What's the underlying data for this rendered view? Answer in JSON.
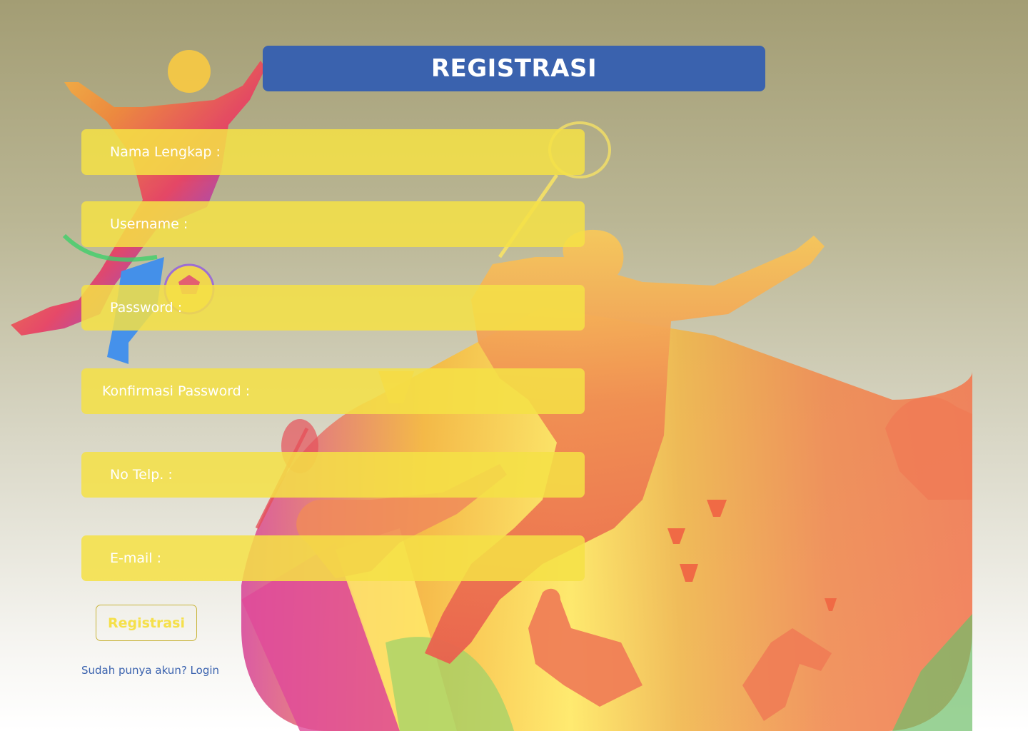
{
  "page": {
    "title": "REGISTRASI"
  },
  "form": {
    "fields": [
      {
        "label": "Nama Lengkap :",
        "value": ""
      },
      {
        "label": "Username :",
        "value": ""
      },
      {
        "label": "Password :",
        "value": ""
      },
      {
        "label": "Konfirmasi Password :",
        "value": ""
      },
      {
        "label": "No Telp. :",
        "value": ""
      },
      {
        "label": "E-mail :",
        "value": ""
      }
    ],
    "submit_label": "Registrasi",
    "login_prompt": "Sudah punya akun? Login"
  },
  "colors": {
    "title_bar": "#3a62ae",
    "field_bg": "#f5e146",
    "button_text": "#f5e04a",
    "link": "#3a62ae"
  },
  "icons": {
    "background_art": "sports-collage-illustration"
  }
}
